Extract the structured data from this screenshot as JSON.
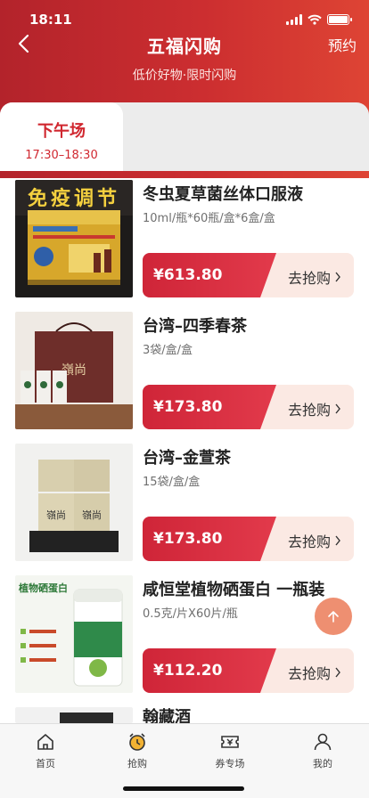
{
  "status_bar": {
    "time": "18:11"
  },
  "nav": {
    "title": "五福闪购",
    "right": "预约",
    "subtitle": "低价好物·限时闪购"
  },
  "session": {
    "name": "下午场",
    "time": "17:30–18:30"
  },
  "grab_label": "去抢购",
  "products": [
    {
      "name": "冬虫夏草菌丝体口服液",
      "spec": "10ml/瓶*60瓶/盒*6盒/盒",
      "price": "¥613.80",
      "image_text": "免疫调节"
    },
    {
      "name": "台湾–四季春茶",
      "spec": "3袋/盒/盒",
      "price": "¥173.80"
    },
    {
      "name": "台湾–金萱茶",
      "spec": "15袋/盒/盒",
      "price": "¥173.80"
    },
    {
      "name": "咸恒堂植物硒蛋白 一瓶装",
      "spec": "0.5克/片X60片/瓶",
      "price": "¥112.20",
      "image_text": "植物硒蛋白"
    },
    {
      "name": "翰藏酒"
    }
  ],
  "tabbar": [
    {
      "label": "首页",
      "icon": "home-icon"
    },
    {
      "label": "抢购",
      "icon": "alarm-clock-icon"
    },
    {
      "label": "券专场",
      "icon": "ticket-icon"
    },
    {
      "label": "我的",
      "icon": "user-icon"
    }
  ],
  "colors": {
    "header_start": "#b3232b",
    "header_end": "#de4434",
    "accent": "#d0272f",
    "price_bg": "#cf2538",
    "grab_bg": "#fbe9e3",
    "active_tab_icon": "#f2b233"
  }
}
